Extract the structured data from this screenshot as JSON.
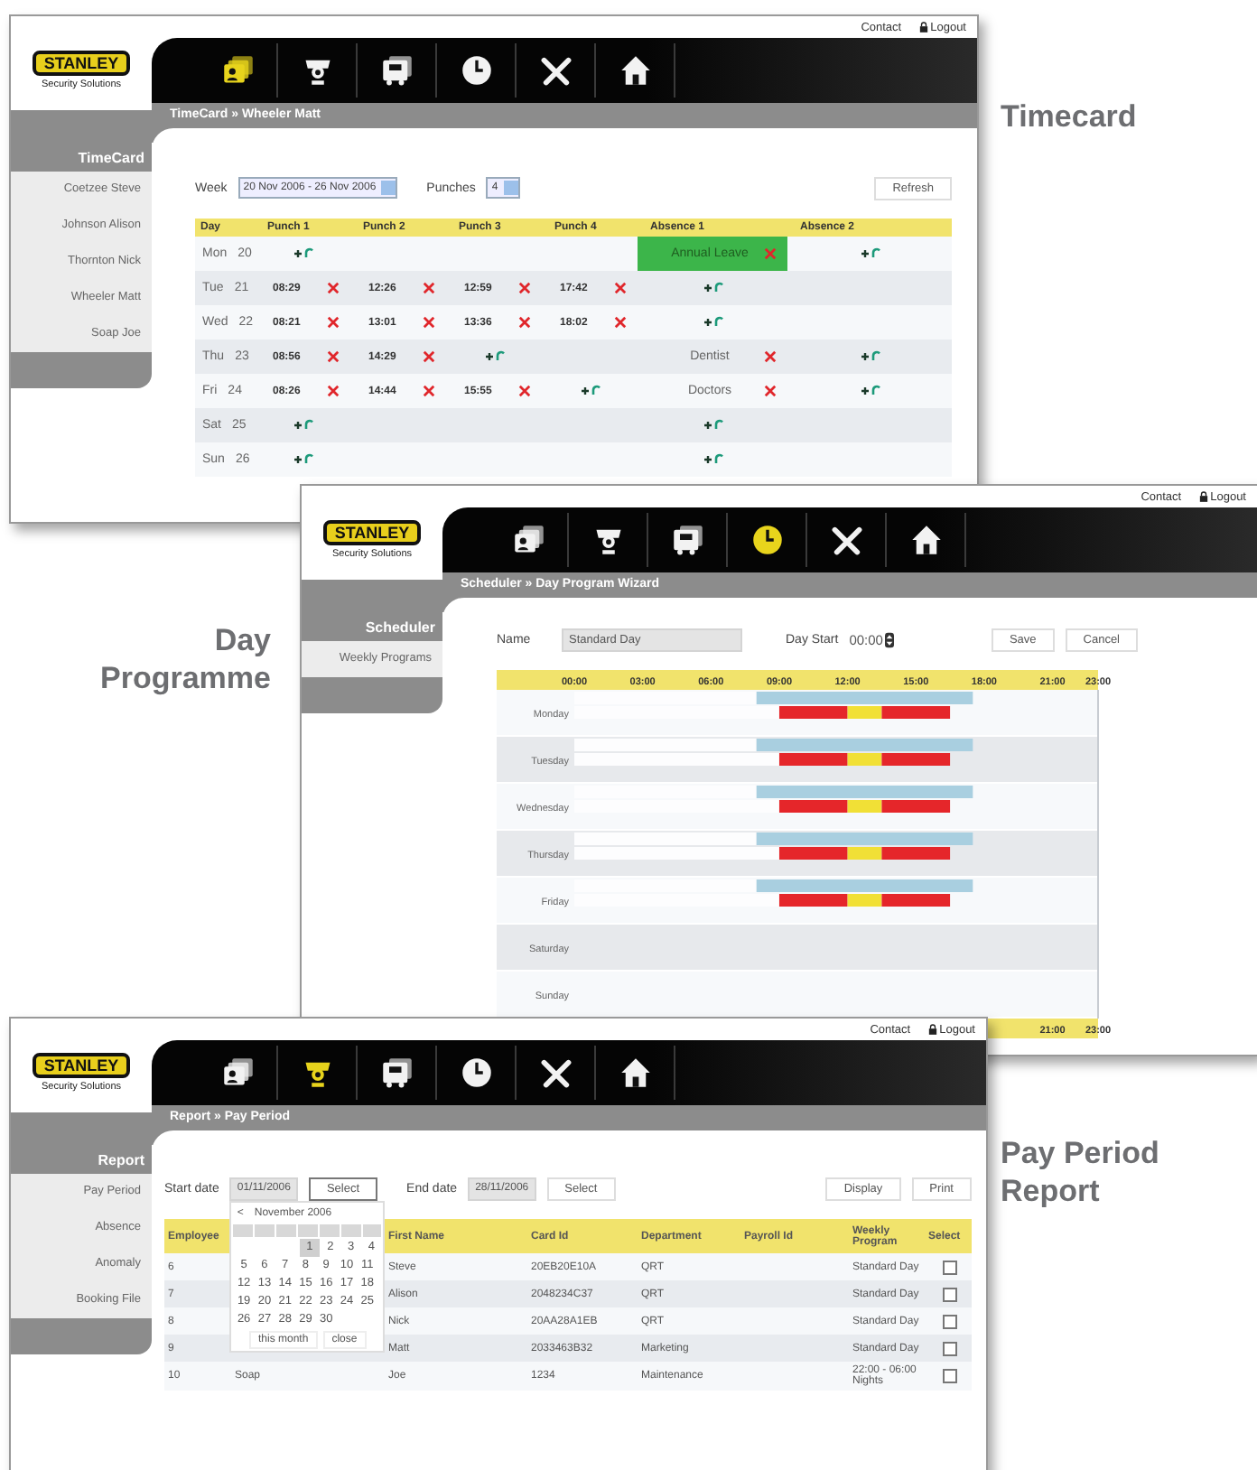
{
  "windows": [
    {
      "kind": "timecard",
      "caption": "Timecard",
      "header_links": [
        {
          "text": "Contact",
          "kind": "plain"
        },
        {
          "text": "Logout",
          "kind": "lock"
        }
      ],
      "logo": {
        "name": "STANLEY",
        "tagline": "Security Solutions"
      },
      "nav_icons": [
        {
          "selected": true
        },
        {
          "selected": false
        },
        {
          "selected": false
        },
        {
          "selected": false
        },
        {
          "selected": false
        },
        {
          "selected": false
        }
      ],
      "breadcrumb": "TimeCard » Wheeler Matt",
      "sidebar": {
        "title": "TimeCard",
        "items": [
          "Coetzee Steve",
          "Johnson Alison",
          "Thornton Nick",
          "Wheeler Matt",
          "Soap Joe"
        ]
      },
      "week_label": "Week",
      "week_value": "20 Nov 2006 - 26 Nov 2006",
      "punches_label": "Punches",
      "punches_value": "4",
      "refresh": "Refresh",
      "columns": [
        "Day",
        "Punch 1",
        "Punch 2",
        "Punch 3",
        "Punch 4",
        "Absence 1",
        "Absence 2"
      ],
      "rows": [
        {
          "cells": [
            {
              "kind": "day",
              "day": "Mon",
              "date": "20"
            },
            {
              "kind": "add"
            },
            {
              "kind": "empty"
            },
            {
              "kind": "empty"
            },
            {
              "kind": "empty"
            },
            {
              "kind": "absence",
              "text": "Annual Leave",
              "highlighted": true
            },
            {
              "kind": "add"
            }
          ]
        },
        {
          "cells": [
            {
              "kind": "day",
              "day": "Tue",
              "date": "21"
            },
            {
              "kind": "time",
              "text": "08:29"
            },
            {
              "kind": "time",
              "text": "12:26"
            },
            {
              "kind": "time",
              "text": "12:59"
            },
            {
              "kind": "time",
              "text": "17:42"
            },
            {
              "kind": "add"
            },
            {
              "kind": "empty"
            }
          ]
        },
        {
          "cells": [
            {
              "kind": "day",
              "day": "Wed",
              "date": "22"
            },
            {
              "kind": "time",
              "text": "08:21"
            },
            {
              "kind": "time",
              "text": "13:01"
            },
            {
              "kind": "time",
              "text": "13:36"
            },
            {
              "kind": "time",
              "text": "18:02"
            },
            {
              "kind": "add"
            },
            {
              "kind": "empty"
            }
          ]
        },
        {
          "cells": [
            {
              "kind": "day",
              "day": "Thu",
              "date": "23"
            },
            {
              "kind": "time",
              "text": "08:56"
            },
            {
              "kind": "time",
              "text": "14:29"
            },
            {
              "kind": "add"
            },
            {
              "kind": "empty"
            },
            {
              "kind": "absence",
              "text": "Dentist",
              "highlighted": false
            },
            {
              "kind": "add"
            }
          ]
        },
        {
          "cells": [
            {
              "kind": "day",
              "day": "Fri",
              "date": "24"
            },
            {
              "kind": "time",
              "text": "08:26"
            },
            {
              "kind": "time",
              "text": "14:44"
            },
            {
              "kind": "time",
              "text": "15:55"
            },
            {
              "kind": "add"
            },
            {
              "kind": "absence",
              "text": "Doctors",
              "highlighted": false
            },
            {
              "kind": "add"
            }
          ]
        },
        {
          "cells": [
            {
              "kind": "day",
              "day": "Sat",
              "date": "25"
            },
            {
              "kind": "add"
            },
            {
              "kind": "empty"
            },
            {
              "kind": "empty"
            },
            {
              "kind": "empty"
            },
            {
              "kind": "add"
            },
            {
              "kind": "empty"
            }
          ]
        },
        {
          "cells": [
            {
              "kind": "day",
              "day": "Sun",
              "date": "26"
            },
            {
              "kind": "add"
            },
            {
              "kind": "empty"
            },
            {
              "kind": "empty"
            },
            {
              "kind": "empty"
            },
            {
              "kind": "add"
            },
            {
              "kind": "empty"
            }
          ]
        }
      ]
    },
    {
      "kind": "scheduler",
      "caption": "Day Programme",
      "header_links": [
        {
          "text": "Contact",
          "kind": "plain"
        },
        {
          "text": "Logout",
          "kind": "lock"
        }
      ],
      "logo": {
        "name": "STANLEY",
        "tagline": "Security Solutions"
      },
      "nav_icons": [
        {
          "selected": false
        },
        {
          "selected": false
        },
        {
          "selected": false
        },
        {
          "selected": true
        },
        {
          "selected": false
        },
        {
          "selected": false
        }
      ],
      "breadcrumb": "Scheduler » Day Program Wizard",
      "sidebar": {
        "title": "Scheduler",
        "items": [
          "Weekly Programs"
        ]
      },
      "name_label": "Name",
      "name_value": "Standard Day",
      "day_start_label": "Day Start",
      "day_start_value": "00:00",
      "buttons": [
        "Save",
        "Cancel"
      ],
      "shift_lane": {
        "chart_data": {
          "type": "bar",
          "orientation": "horizontal",
          "stacked": true,
          "categories": [
            "Monday",
            "Tuesday",
            "Wednesday",
            "Thursday",
            "Friday",
            "Saturday",
            "Sunday"
          ],
          "xlim": [
            0,
            23
          ],
          "xticks": [
            {
              "value": 0,
              "label": "00:00"
            },
            {
              "value": 3,
              "label": "03:00"
            },
            {
              "value": 6,
              "label": "06:00"
            },
            {
              "value": 9,
              "label": "09:00"
            },
            {
              "value": 12,
              "label": "12:00"
            },
            {
              "value": 15,
              "label": "15:00"
            },
            {
              "value": 18,
              "label": "18:00"
            },
            {
              "value": 21,
              "label": "21:00"
            },
            {
              "value": 23,
              "label": "23:00"
            }
          ],
          "series": [
            {
              "color": "#fdfdfe",
              "values": [
                8,
                8,
                8,
                8,
                8,
                null,
                null
              ]
            },
            {
              "color": "#a9cfe0",
              "values": [
                9.5,
                9.5,
                9.5,
                9.5,
                9.5,
                null,
                null
              ]
            }
          ]
        }
      },
      "period_lane": {
        "chart_data": {
          "type": "bar",
          "orientation": "horizontal",
          "stacked": true,
          "xlim": [
            0,
            23
          ],
          "series": [
            {
              "color": "#fdfdfe",
              "values": [
                9,
                9,
                9,
                9,
                9,
                null,
                null
              ]
            },
            {
              "color": "#e5262a",
              "values": [
                3,
                3,
                3,
                3,
                3,
                null,
                null
              ]
            },
            {
              "color": "#f1e036",
              "values": [
                1.5,
                1.5,
                1.5,
                1.5,
                1.5,
                null,
                null
              ]
            },
            {
              "color": "#e5262a",
              "values": [
                3,
                3,
                3,
                3,
                3,
                null,
                null
              ]
            }
          ]
        }
      },
      "footer_ticks": [
        "21:00",
        "23:00"
      ]
    },
    {
      "kind": "report",
      "caption": "Pay Period Report",
      "header_links": [
        {
          "text": "Contact",
          "kind": "plain"
        },
        {
          "text": "Logout",
          "kind": "lock"
        }
      ],
      "logo": {
        "name": "STANLEY",
        "tagline": "Security Solutions"
      },
      "nav_icons": [
        {
          "selected": false
        },
        {
          "selected": true
        },
        {
          "selected": false
        },
        {
          "selected": false
        },
        {
          "selected": false
        },
        {
          "selected": false
        }
      ],
      "breadcrumb": "Report » Pay Period",
      "sidebar": {
        "title": "Report",
        "items": [
          "Pay Period",
          "Absence",
          "Anomaly",
          "Booking File"
        ]
      },
      "start_label": "Start date",
      "start_value": "01/11/2006",
      "start_select": "Select",
      "end_label": "End date",
      "end_value": "28/11/2006",
      "end_select": "Select",
      "buttons": [
        "Display",
        "Print"
      ],
      "calendar": {
        "prev": "<",
        "month": "November 2006",
        "weeks": [
          [
            {
              "text": "1",
              "selected": true
            },
            {
              "text": "2",
              "selected": false
            },
            {
              "text": "3",
              "selected": false
            },
            {
              "text": "4",
              "selected": false
            }
          ],
          [
            {
              "text": "5",
              "selected": false
            },
            {
              "text": "6",
              "selected": false
            },
            {
              "text": "7",
              "selected": false
            },
            {
              "text": "8",
              "selected": false
            },
            {
              "text": "9",
              "selected": false
            },
            {
              "text": "10",
              "selected": false
            },
            {
              "text": "11",
              "selected": false
            }
          ],
          [
            {
              "text": "12",
              "selected": false
            },
            {
              "text": "13",
              "selected": false
            },
            {
              "text": "14",
              "selected": false
            },
            {
              "text": "15",
              "selected": false
            },
            {
              "text": "16",
              "selected": false
            },
            {
              "text": "17",
              "selected": false
            },
            {
              "text": "18",
              "selected": false
            }
          ],
          [
            {
              "text": "19",
              "selected": false
            },
            {
              "text": "20",
              "selected": false
            },
            {
              "text": "21",
              "selected": false
            },
            {
              "text": "22",
              "selected": false
            },
            {
              "text": "23",
              "selected": false
            },
            {
              "text": "24",
              "selected": false
            },
            {
              "text": "25",
              "selected": false
            }
          ],
          [
            {
              "text": "26",
              "selected": false
            },
            {
              "text": "27",
              "selected": false
            },
            {
              "text": "28",
              "selected": false
            },
            {
              "text": "29",
              "selected": false
            },
            {
              "text": "30",
              "selected": false
            }
          ]
        ],
        "buttons": [
          "this month",
          "close"
        ]
      },
      "columns": [
        "Employee",
        "First Name",
        "Card Id",
        "Department",
        "Payroll Id",
        "Weekly Program",
        "Select"
      ],
      "rows": [
        {
          "employee": "6",
          "first_name": "Steve",
          "card_id": "20EB20E10A",
          "department": "QRT",
          "weekly_program": "Standard Day",
          "checked": false
        },
        {
          "employee": "7",
          "first_name": "Alison",
          "card_id": "2048234C37",
          "department": "QRT",
          "weekly_program": "Standard Day",
          "checked": false
        },
        {
          "employee": "8",
          "first_name": "Nick",
          "card_id": "20AA28A1EB",
          "department": "QRT",
          "weekly_program": "Standard Day",
          "checked": false
        },
        {
          "employee": "9",
          "first_name": "Matt",
          "card_id": "2033463B32",
          "department": "Marketing",
          "weekly_program": "Standard Day",
          "checked": false
        },
        {
          "employee": "10",
          "column_2": "Soap",
          "first_name": "Joe",
          "card_id": "1234",
          "department": "Maintenance",
          "weekly_program": "22:00 - 06:00 Nights",
          "checked": false
        }
      ]
    }
  ]
}
